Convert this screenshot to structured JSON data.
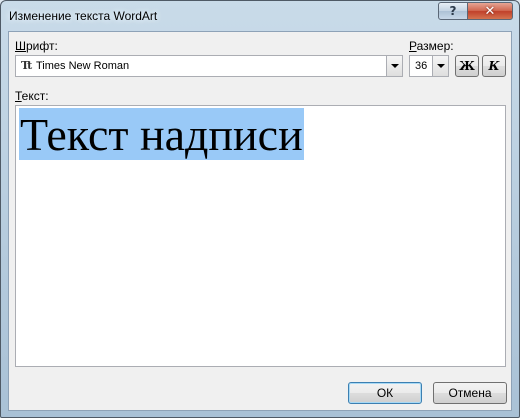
{
  "window": {
    "title": "Изменение текста WordArt",
    "help_glyph": "?",
    "close_glyph": "✕"
  },
  "font": {
    "label_prefix": "",
    "label_accel": "Ш",
    "label_rest": "рифт:",
    "icon_glyph": "Tt",
    "value": "Times New Roman"
  },
  "size": {
    "label_prefix": "",
    "label_accel": "Р",
    "label_rest": "азмер:",
    "value": "36"
  },
  "format": {
    "bold_glyph": "Ж",
    "italic_glyph": "К"
  },
  "text": {
    "label_accel": "Т",
    "label_rest": "екст:",
    "value": "Текст надписи",
    "selected": true
  },
  "buttons": {
    "ok": "ОК",
    "cancel": "Отмена"
  },
  "colors": {
    "selection": "#99c9f7",
    "close_button": "#c9452d"
  }
}
